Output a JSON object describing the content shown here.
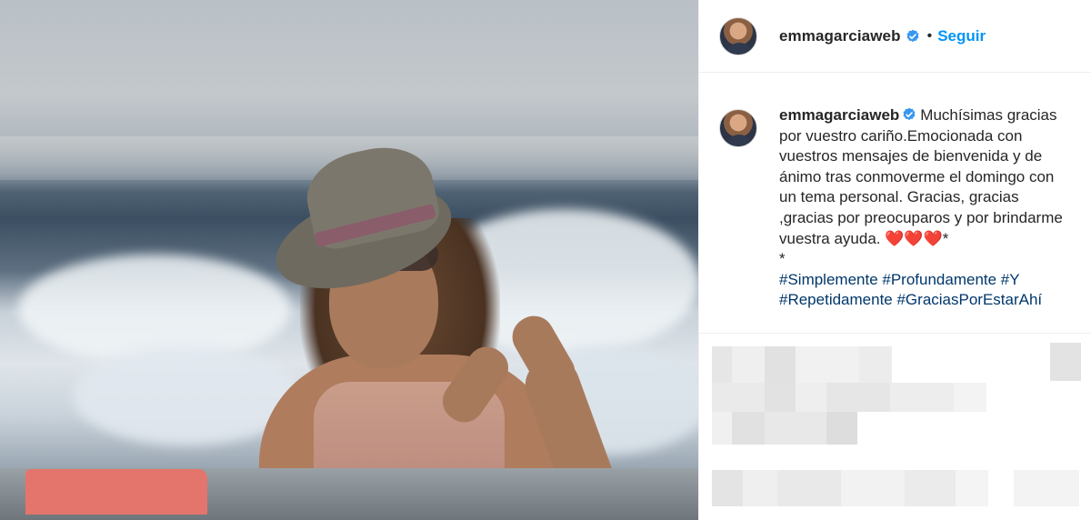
{
  "post": {
    "author": {
      "username": "emmagarciaweb",
      "verified": true,
      "avatar_icon": "profile-avatar"
    },
    "header": {
      "separator": "•",
      "follow_label": "Seguir",
      "follow_color": "#0095f6"
    },
    "caption": {
      "username": "emmagarciaweb",
      "text": "Muchísimas gracias por vuestro cariño.Emocionada con vuestros mensajes de bienvenida y de ánimo tras conmoverme el domingo con un tema personal. Gracias, gracias ,gracias por preocuparos y por brindarme vuestra ayuda. ❤️❤️❤️*\n*",
      "hashtags": "#Simplemente #Profundamente #Y #Repetidamente #GraciasPorEstarAhí",
      "hashtag_color": "#00376b"
    },
    "comments_area": {
      "state": "pixelated"
    }
  }
}
